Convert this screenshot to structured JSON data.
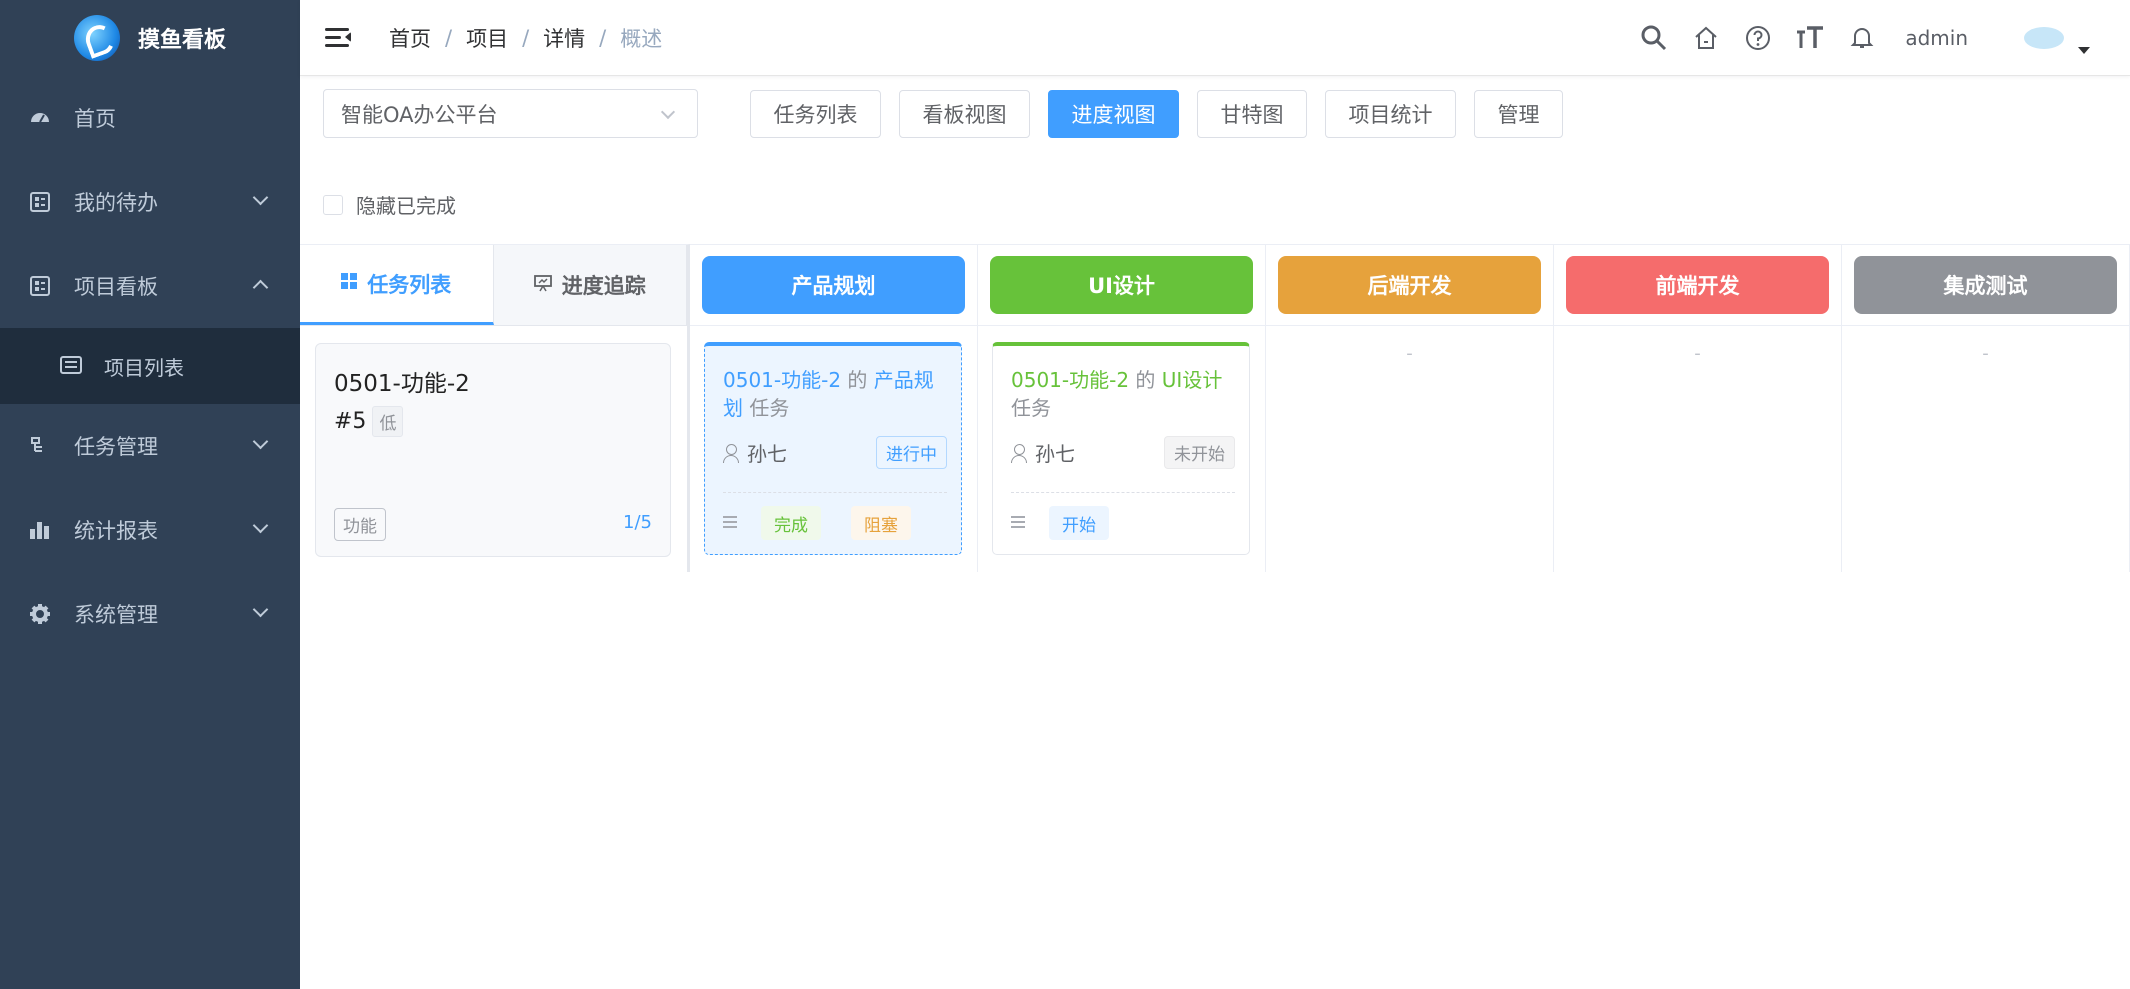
{
  "app": {
    "logo_text": "摸鱼看板"
  },
  "sidebar": {
    "items": [
      {
        "label": "首页",
        "icon": "dashboard-icon"
      },
      {
        "label": "我的待办",
        "icon": "todo-icon"
      },
      {
        "label": "项目看板",
        "icon": "board-icon",
        "expanded": true
      },
      {
        "label": "项目列表",
        "icon": "list-icon",
        "sub": true
      },
      {
        "label": "任务管理",
        "icon": "tree-icon"
      },
      {
        "label": "统计报表",
        "icon": "chart-icon"
      },
      {
        "label": "系统管理",
        "icon": "gear-icon"
      }
    ]
  },
  "header": {
    "breadcrumb": [
      "首页",
      "项目",
      "详情",
      "概述"
    ],
    "username": "admin"
  },
  "toolbar": {
    "project_select": "智能OA办公平台",
    "tabs": [
      "任务列表",
      "看板视图",
      "进度视图",
      "甘特图",
      "项目统计",
      "管理"
    ],
    "active_tab": "进度视图",
    "hide_done_label": "隐藏已完成"
  },
  "left_panel": {
    "tabs": [
      "任务列表",
      "进度追踪"
    ],
    "task": {
      "title": "0501-功能-2",
      "number": "#5",
      "priority": "低",
      "tag": "功能",
      "progress": "1/5"
    }
  },
  "stages": [
    {
      "name": "产品规划",
      "color": "#409eff"
    },
    {
      "name": "UI设计",
      "color": "#67c23a"
    },
    {
      "name": "后端开发",
      "color": "#e6a23c"
    },
    {
      "name": "前端开发",
      "color": "#f56c6c"
    },
    {
      "name": "集成测试",
      "color": "#909399"
    }
  ],
  "empty_placeholder": "-",
  "stage_cards": {
    "product": {
      "task": "0501-功能-2",
      "of": "的",
      "stage": "产品规划",
      "suffix": "任务",
      "user": "孙七",
      "status": "进行中",
      "btn1": "完成",
      "btn2": "阻塞"
    },
    "ui": {
      "task": "0501-功能-2",
      "of": "的",
      "stage": "UI设计",
      "suffix": "任务",
      "user": "孙七",
      "status": "未开始",
      "btn1": "开始"
    }
  }
}
